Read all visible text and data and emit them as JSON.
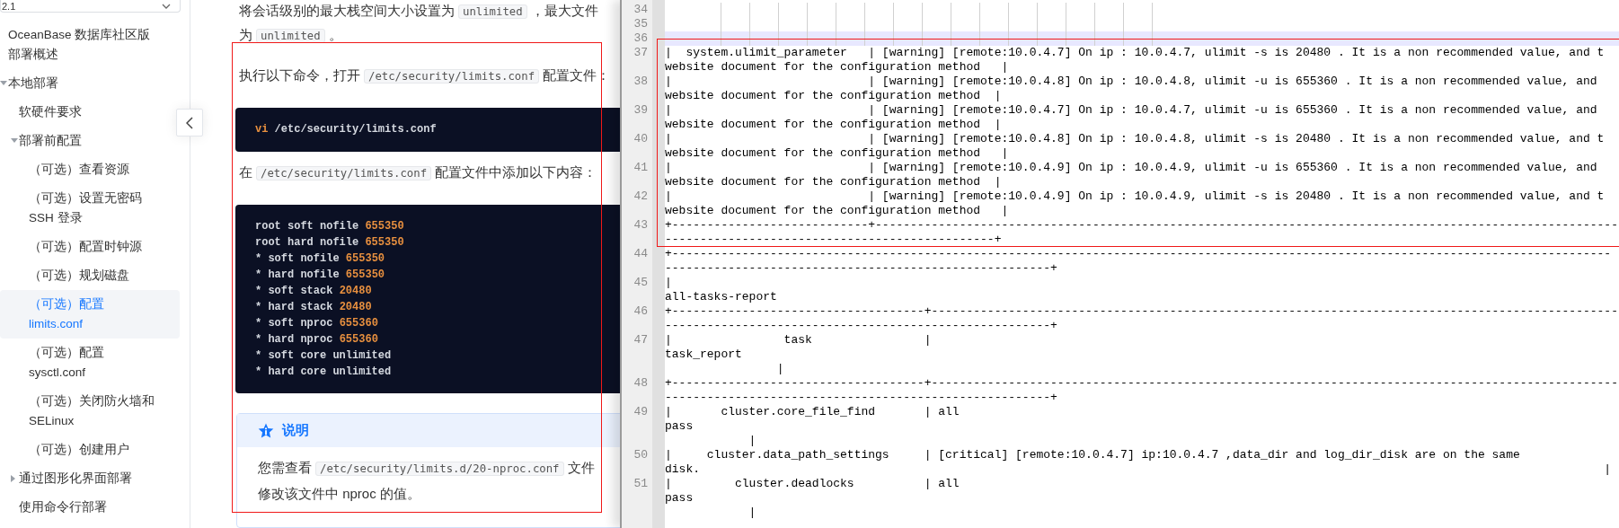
{
  "sidebar": {
    "version_select": {
      "value": "2.1"
    },
    "items": [
      {
        "label": "OceanBase 数据库社区版部署概述",
        "selected": false
      },
      {
        "label": "本地部署",
        "selected": false,
        "expanded": true,
        "children": [
          {
            "label": "软硬件要求",
            "selected": false
          },
          {
            "label": "部署前配置",
            "selected": false,
            "expanded": true,
            "children": [
              {
                "label": "（可选）查看资源",
                "selected": false
              },
              {
                "label": "（可选）设置无密码 SSH 登录",
                "selected": false
              },
              {
                "label": "（可选）配置时钟源",
                "selected": false
              },
              {
                "label": "（可选）规划磁盘",
                "selected": false
              },
              {
                "label": "（可选）配置 limits.conf",
                "selected": true
              },
              {
                "label": "（可选）配置 sysctl.conf",
                "selected": false
              },
              {
                "label": "（可选）关闭防火墙和 SELinux",
                "selected": false
              },
              {
                "label": "（可选）创建用户",
                "selected": false
              }
            ]
          },
          {
            "label": "通过图形化界面部署",
            "selected": false,
            "expanded": false
          },
          {
            "label": "使用命令行部署",
            "selected": false
          }
        ]
      }
    ]
  },
  "article": {
    "blocks": [
      {
        "kind": "paragraph",
        "lines": [
          [
            {
              "kind": "text",
              "text": "将会话级别的最大栈空间大小设置为"
            },
            {
              "kind": "code",
              "text": "unlimited"
            },
            {
              "kind": "text",
              "text": "，最大文件"
            }
          ],
          [
            {
              "kind": "text",
              "text": "为"
            },
            {
              "kind": "code",
              "text": "unlimited"
            },
            {
              "kind": "text",
              "text": "。"
            }
          ]
        ]
      },
      {
        "kind": "paragraph",
        "lines": [
          [
            {
              "kind": "text",
              "text": "执行以下命令，打开"
            },
            {
              "kind": "code",
              "text": "/etc/security/limits.conf"
            },
            {
              "kind": "text",
              "text": "配置文件："
            }
          ]
        ]
      },
      {
        "kind": "code",
        "lines": [
          [
            {
              "kind": "keyword",
              "text": "vi"
            },
            {
              "kind": "plain",
              "text": " /etc/security/limits.conf"
            }
          ]
        ]
      },
      {
        "kind": "paragraph",
        "lines": [
          [
            {
              "kind": "text",
              "text": "在"
            },
            {
              "kind": "code",
              "text": "/etc/security/limits.conf"
            },
            {
              "kind": "text",
              "text": "配置文件中添加以下内容："
            }
          ]
        ]
      },
      {
        "kind": "code",
        "lines": [
          [
            {
              "kind": "plain",
              "text": "root soft nofile "
            },
            {
              "kind": "number",
              "text": "655350"
            }
          ],
          [
            {
              "kind": "plain",
              "text": "root hard nofile "
            },
            {
              "kind": "number",
              "text": "655350"
            }
          ],
          [
            {
              "kind": "plain",
              "text": "* soft nofile "
            },
            {
              "kind": "number",
              "text": "655350"
            }
          ],
          [
            {
              "kind": "plain",
              "text": "* hard nofile "
            },
            {
              "kind": "number",
              "text": "655350"
            }
          ],
          [
            {
              "kind": "plain",
              "text": "* soft stack "
            },
            {
              "kind": "number",
              "text": "20480"
            }
          ],
          [
            {
              "kind": "plain",
              "text": "* hard stack "
            },
            {
              "kind": "number",
              "text": "20480"
            }
          ],
          [
            {
              "kind": "plain",
              "text": "* soft nproc "
            },
            {
              "kind": "number",
              "text": "655360"
            }
          ],
          [
            {
              "kind": "plain",
              "text": "* hard nproc "
            },
            {
              "kind": "number",
              "text": "655360"
            }
          ],
          [
            {
              "kind": "plain",
              "text": "* soft core unlimited"
            }
          ],
          [
            {
              "kind": "plain",
              "text": "* hard core unlimited"
            }
          ]
        ]
      },
      {
        "kind": "note",
        "title": "说明",
        "lines": [
          [
            {
              "kind": "text",
              "text": "您需查看"
            },
            {
              "kind": "code",
              "text": "/etc/security/limits.d/20-nproc.conf"
            },
            {
              "kind": "text",
              "text": "文件"
            }
          ],
          [
            {
              "kind": "text",
              "text": "修改该文件中 nproc 的值。"
            }
          ]
        ]
      }
    ]
  },
  "editor": {
    "lines": [
      {
        "number": "34",
        "current": false
      },
      {
        "number": "35",
        "current": false
      },
      {
        "number": "36",
        "current": true
      },
      {
        "number": "37",
        "current": false,
        "text_lines": [
          "|  system.ulimit_parameter   | [warning] [remote:10.0.4.7] On ip : 10.0.4.7, ulimit -s is 20480 . It is a non recommended value, and t",
          "website document for the configuration method   |"
        ]
      },
      {
        "number": "38",
        "current": false,
        "text_lines": [
          "|                            | [warning] [remote:10.0.4.8] On ip : 10.0.4.8, ulimit -u is 655360 . It is a non recommended value, and",
          "website document for the configuration method  |"
        ]
      },
      {
        "number": "39",
        "current": false,
        "text_lines": [
          "|                            | [warning] [remote:10.0.4.7] On ip : 10.0.4.7, ulimit -u is 655360 . It is a non recommended value, and",
          "website document for the configuration method  |"
        ]
      },
      {
        "number": "40",
        "current": false,
        "text_lines": [
          "|                            | [warning] [remote:10.0.4.8] On ip : 10.0.4.8, ulimit -s is 20480 . It is a non recommended value, and t",
          "website document for the configuration method   |"
        ]
      },
      {
        "number": "41",
        "current": false,
        "text_lines": [
          "|                            | [warning] [remote:10.0.4.9] On ip : 10.0.4.9, ulimit -u is 655360 . It is a non recommended value, and",
          "website document for the configuration method  |"
        ]
      },
      {
        "number": "42",
        "current": false,
        "text_lines": [
          "|                            | [warning] [remote:10.0.4.9] On ip : 10.0.4.9, ulimit -s is 20480 . It is a non recommended value, and t",
          "website document for the configuration method   |"
        ]
      },
      {
        "number": "43",
        "current": false,
        "text_lines": [
          "+----------------------------+----------------------------------------------------------------------------------------------------------",
          "-----------------------------------------------+"
        ]
      },
      {
        "number": "44",
        "current": false,
        "text_lines": [
          "+--------------------------------------------------------------------------------------------------------------------------------------",
          "-------------------------------------------------------+"
        ]
      },
      {
        "number": "45",
        "current": false,
        "text_lines": [
          "|",
          "all-tasks-report"
        ]
      },
      {
        "number": "46",
        "current": false,
        "text_lines": [
          "+------------------------------------+--------------------------------------------------------------------------------------------------",
          "-------------------------------------------------------+"
        ]
      },
      {
        "number": "47",
        "current": false,
        "text_lines": [
          "|                task                |",
          "task_report",
          "                |"
        ]
      },
      {
        "number": "48",
        "current": false,
        "text_lines": [
          "+------------------------------------+--------------------------------------------------------------------------------------------------",
          "-------------------------------------------------------+"
        ]
      },
      {
        "number": "49",
        "current": false,
        "text_lines": [
          "|       cluster.core_file_find       | all",
          "pass",
          "            |"
        ]
      },
      {
        "number": "50",
        "current": false,
        "text_lines": [
          "|     cluster.data_path_settings     | [critical] [remote:10.0.4.7] ip:10.0.4.7 ,data_dir and log_dir_disk are on the same",
          "disk.                                                                                                                                 |"
        ]
      },
      {
        "number": "51",
        "current": false,
        "text_lines": [
          "|         cluster.deadlocks          | all",
          "pass",
          "            |"
        ]
      }
    ]
  }
}
